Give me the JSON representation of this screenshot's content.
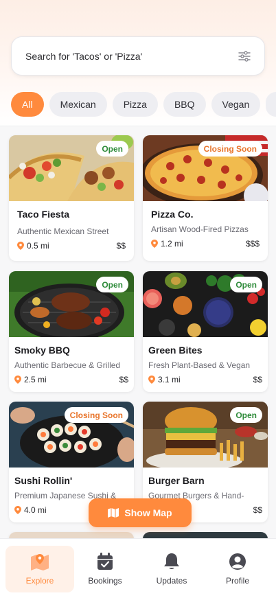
{
  "search": {
    "placeholder": "Search for 'Tacos' or 'Pizza'"
  },
  "chips": [
    "All",
    "Mexican",
    "Pizza",
    "BBQ",
    "Vegan"
  ],
  "restaurants": [
    {
      "name": "Taco Fiesta",
      "description": "Authentic Mexican Street",
      "distance": "0.5 mi",
      "price": "$$",
      "status": "Open"
    },
    {
      "name": "Pizza Co.",
      "description": "Artisan Wood-Fired Pizzas",
      "distance": "1.2 mi",
      "price": "$$$",
      "status": "Closing Soon"
    },
    {
      "name": "Smoky BBQ",
      "description": "Authentic Barbecue & Grilled",
      "distance": "2.5 mi",
      "price": "$$",
      "status": "Open"
    },
    {
      "name": "Green Bites",
      "description": "Fresh Plant-Based & Vegan",
      "distance": "3.1 mi",
      "price": "$$",
      "status": "Open"
    },
    {
      "name": "Sushi Rollin'",
      "description": "Premium Japanese Sushi &",
      "distance": "4.0 mi",
      "price": "",
      "status": "Closing Soon"
    },
    {
      "name": "Burger Barn",
      "description": "Gourmet Burgers & Hand-",
      "distance": "",
      "price": "$$",
      "status": "Open"
    }
  ],
  "show_map": {
    "label": "Show Map"
  },
  "tabbar": {
    "explore": "Explore",
    "bookings": "Bookings",
    "updates": "Updates",
    "profile": "Profile"
  },
  "colors": {
    "accent": "#ff8a3d",
    "open": "#2e8b3a",
    "closing": "#e8742a"
  }
}
